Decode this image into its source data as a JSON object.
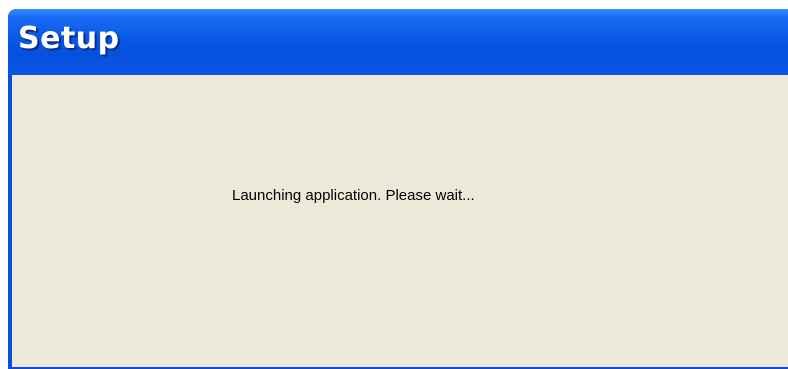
{
  "window": {
    "title": "Setup",
    "message": "Launching application. Please wait..."
  },
  "colors": {
    "titlebar": "#0a5ae6",
    "client_background": "#ece9d8",
    "title_text": "#ffffff",
    "message_text": "#000000"
  }
}
